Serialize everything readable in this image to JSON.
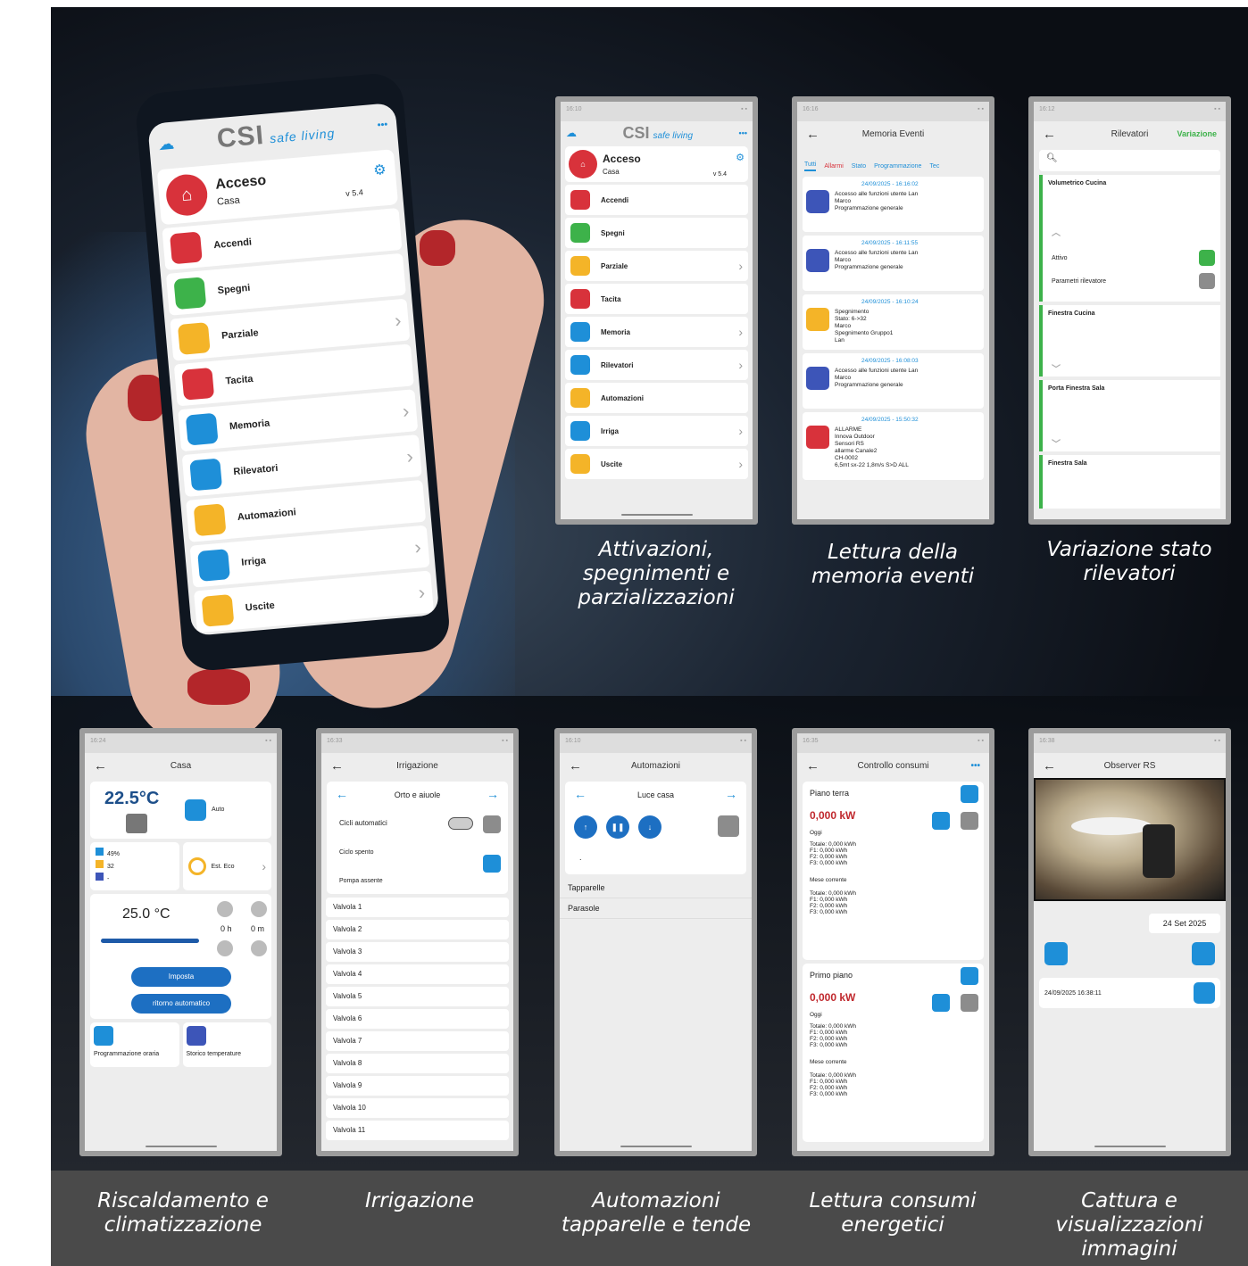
{
  "phone": {
    "time": "16:10",
    "brand": "CSI",
    "brand_sub": "safe living",
    "more": "•••",
    "status_title": "Acceso",
    "status_sub": "Casa",
    "version": "v 5.4",
    "items": [
      {
        "label": "Accendi",
        "color": "#d8323b"
      },
      {
        "label": "Spegni",
        "color": "#3db24a"
      },
      {
        "label": "Parziale",
        "color": "#f4b428",
        "chev": true
      },
      {
        "label": "Tacita",
        "color": "#d8323b"
      },
      {
        "label": "Memoria",
        "color": "#1e8fd8",
        "chev": true
      },
      {
        "label": "Rilevatori",
        "color": "#1e8fd8",
        "chev": true
      },
      {
        "label": "Automazioni",
        "color": "#f4b428"
      },
      {
        "label": "Irriga",
        "color": "#1e8fd8",
        "chev": true
      },
      {
        "label": "Uscite",
        "color": "#f4b428",
        "chev": true
      }
    ]
  },
  "captions": {
    "c1": "Attivazioni, spegnimenti e parzializzazioni",
    "c2": "Lettura della memoria eventi",
    "c3": "Variazione stato rilevatori",
    "c4": "Riscaldamento e climatizzazione",
    "c5": "Irrigazione",
    "c6": "Automazioni tapparelle e tende",
    "c7": "Lettura consumi energetici",
    "c8": "Cattura e visualizzazioni immagini"
  },
  "s1": {
    "time": "16:10",
    "brand": "CSI",
    "brand_sub": "safe living",
    "status_title": "Acceso",
    "status_sub": "Casa",
    "version": "v 5.4",
    "items": [
      "Accendi",
      "Spegni",
      "Parziale",
      "Tacita",
      "Memoria",
      "Rilevatori",
      "Automazioni",
      "Irriga",
      "Uscite"
    ]
  },
  "s2": {
    "time": "16:16",
    "title": "Memoria Eventi",
    "tabs": [
      "Tutti",
      "Allarmi",
      "Stato",
      "Programmazione",
      "Tec"
    ],
    "events": [
      {
        "date": "24/09/2025 - 16:16:02",
        "lines": [
          "Accesso alle funzioni utente Lan",
          "Marco",
          "Programmazione generale"
        ]
      },
      {
        "date": "24/09/2025 - 16:11:55",
        "lines": [
          "Accesso alle funzioni utente Lan",
          "Marco",
          "Programmazione generale"
        ]
      },
      {
        "date": "24/09/2025 - 16:10:24",
        "lines": [
          "Spegnimento",
          "Stato: 6->32",
          "Marco",
          "Spegnimento Gruppo1",
          "Lan"
        ]
      },
      {
        "date": "24/09/2025 - 16:08:03",
        "lines": [
          "Accesso alle funzioni utente Lan",
          "Marco",
          "Programmazione generale"
        ]
      },
      {
        "date": "24/09/2025 - 15:50:32",
        "lines": [
          "ALLARME",
          "Innova Outdoor",
          "Sensori RS",
          "allarme Canale2",
          "CH-0002",
          "6,5mt sx-22 1,8m/s S>D ALL"
        ]
      }
    ]
  },
  "s3": {
    "time": "16:12",
    "title": "Rilevatori",
    "action": "Variazione",
    "d1": "Volumetrico Cucina",
    "attivo": "Attivo",
    "params": "Parametri rilevatore",
    "d2": "Finestra Cucina",
    "d3": "Porta Finestra Sala",
    "d4": "Finestra Sala"
  },
  "s4": {
    "time": "16:24",
    "title": "Casa",
    "temp": "22.5°C",
    "mode": "Auto",
    "hum": "49%",
    "v32": "32",
    "dash": "-",
    "eco": "Est. Eco",
    "set": "25.0 °C",
    "h": "0 h",
    "m": "0 m",
    "b1": "Imposta",
    "b2": "ritorno automatico",
    "p1": "Programmazione oraria",
    "p2": "Storico temperature"
  },
  "s5": {
    "time": "16:33",
    "title": "Irrigazione",
    "zone": "Orto e aiuole",
    "cicli": "Cicli automatici",
    "spento": "Ciclo spento",
    "pompa": "Pompa assente",
    "valves": [
      "Valvola 1",
      "Valvola 2",
      "Valvola 3",
      "Valvola 4",
      "Valvola 5",
      "Valvola 6",
      "Valvola 7",
      "Valvola 8",
      "Valvola 9",
      "Valvola 10",
      "Valvola 11"
    ]
  },
  "s6": {
    "time": "16:10",
    "title": "Automazioni",
    "group": "Luce casa",
    "dot": ".",
    "i1": "Tapparelle",
    "i2": "Parasole"
  },
  "s7": {
    "time": "16:35",
    "title": "Controllo consumi",
    "floors": [
      {
        "name": "Piano terra",
        "kw": "0,000 kW",
        "oggi": "Oggi",
        "t1": "Totale: 0,000 kWh",
        "f1": "F1: 0,000 kWh",
        "f2": "F2: 0,000 kWh",
        "f3": "F3: 0,000 kWh",
        "mese": "Mese corrente",
        "t2": "Totale: 0,000 kWh",
        "g1": "F1: 0,000 kWh",
        "g2": "F2: 0,000 kWh",
        "g3": "F3: 0,000 kWh"
      },
      {
        "name": "Primo piano",
        "kw": "0,000 kW",
        "oggi": "Oggi",
        "t1": "Totale: 0,000 kWh",
        "f1": "F1: 0,000 kWh",
        "f2": "F2: 0,000 kWh",
        "f3": "F3: 0,000 kWh",
        "mese": "Mese corrente",
        "t2": "Totale: 0,000 kWh",
        "g1": "F1: 0,000 kWh",
        "g2": "F2: 0,000 kWh",
        "g3": "F3: 0,000 kWh"
      }
    ]
  },
  "s8": {
    "time": "16:38",
    "title": "Observer RS",
    "date": "24 Set 2025",
    "entry": "24/09/2025 16:38:11"
  }
}
